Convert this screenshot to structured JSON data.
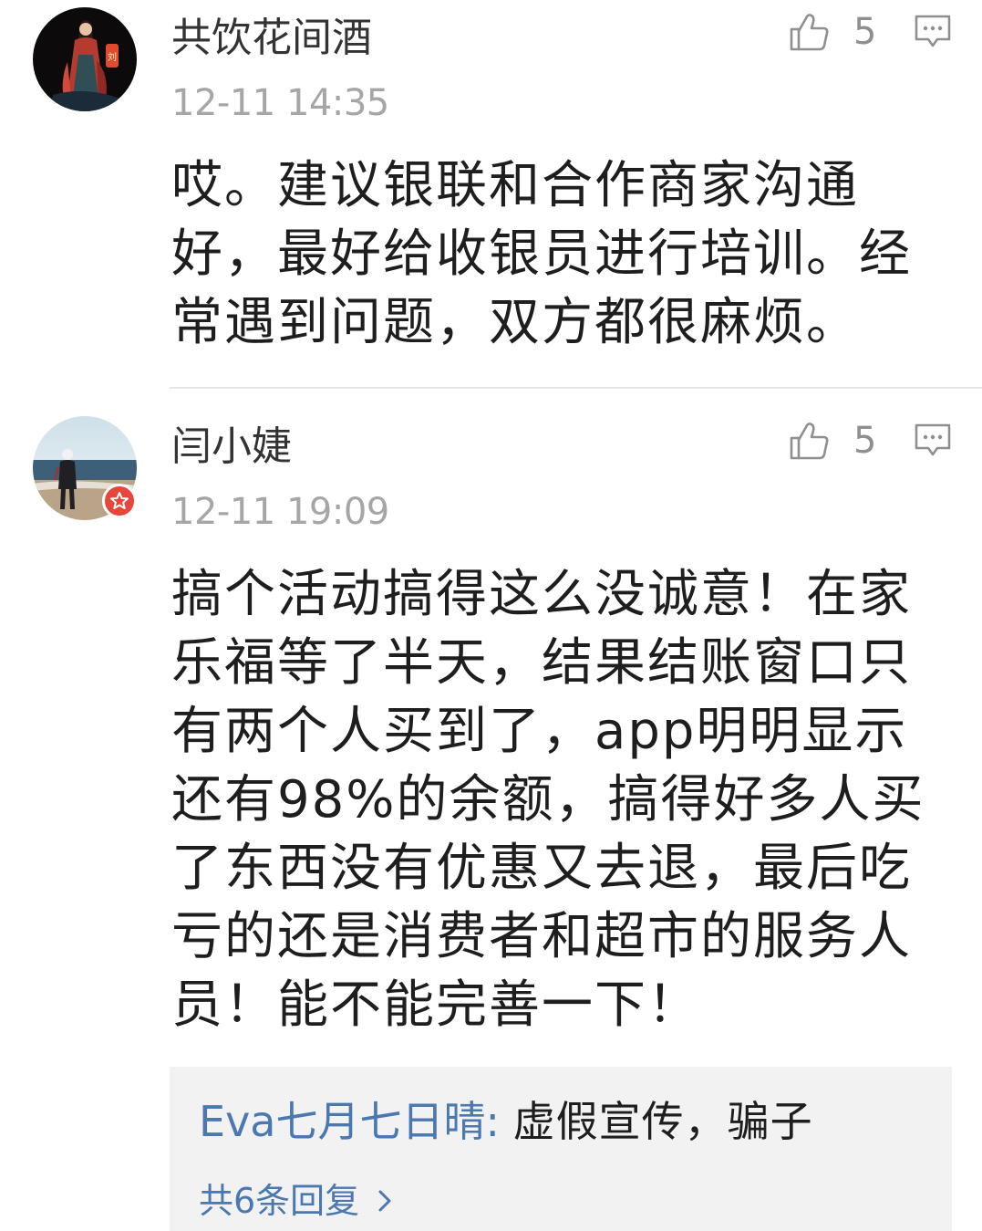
{
  "comments": [
    {
      "username": "共饮花间酒",
      "timestamp": "12-11 14:35",
      "likes": "5",
      "content": "哎。建议银联和合作商家沟通好，最好给收银员进行培训。经常遇到问题，双方都很麻烦。",
      "avatar_icon": "avatar-costume-figure-icon",
      "verified": false
    },
    {
      "username": "闫小婕",
      "timestamp": "12-11 19:09",
      "likes": "5",
      "content": "搞个活动搞得这么没诚意！在家乐福等了半天，结果结账窗口只有两个人买到了，app明明显示还有98%的余额，搞得好多人买了东西没有优惠又去退，最后吃亏的还是消费者和超市的服务人员！能不能完善一下！",
      "avatar_icon": "avatar-beach-photo-icon",
      "verified": true,
      "replies": {
        "preview": {
          "author": "Eva七月七日晴",
          "separator": ": ",
          "text": "虚假宣传，骗子"
        },
        "more_label": "共6条回复"
      }
    }
  ],
  "colors": {
    "link_blue": "#4a78b0",
    "meta_gray": "#a6a6a6",
    "badge_red": "#e8463a",
    "reply_bg": "#f2f2f2"
  }
}
